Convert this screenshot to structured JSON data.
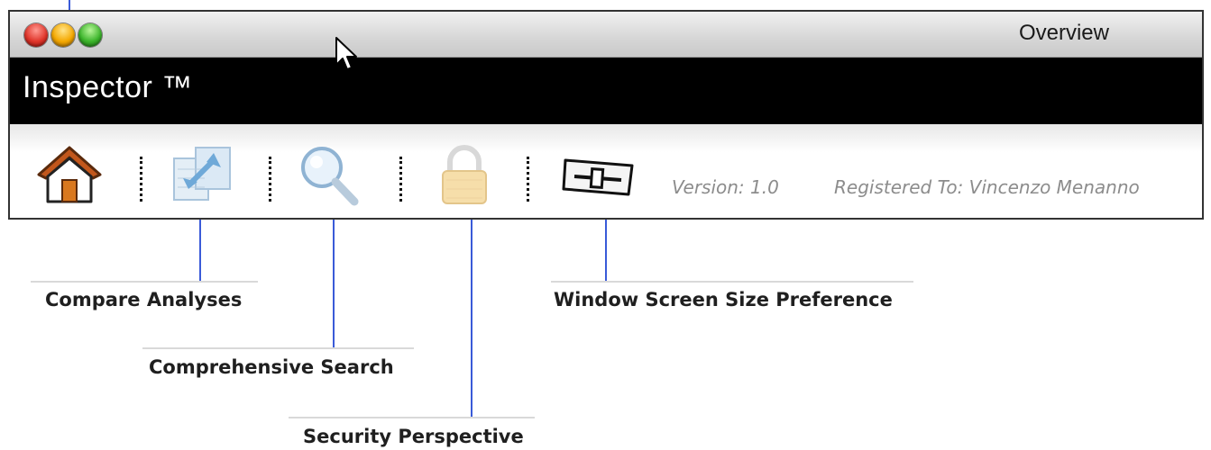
{
  "window": {
    "title": "Overview",
    "app_name": "Inspector ™"
  },
  "toolbar": {
    "buttons": [
      {
        "id": "home",
        "icon": "home-icon"
      },
      {
        "id": "compare",
        "icon": "compare-analyses-icon"
      },
      {
        "id": "search",
        "icon": "magnifier-icon"
      },
      {
        "id": "security",
        "icon": "padlock-icon"
      },
      {
        "id": "window-size",
        "icon": "slider-icon"
      }
    ],
    "version": "Version: 1.0",
    "registered": "Registered To: Vincenzo Menanno"
  },
  "callouts": {
    "compare": "Compare Analyses",
    "search": "Comprehensive Search",
    "security": "Security Perspective",
    "window_size": "Window Screen Size Preference"
  },
  "colors": {
    "callout_line": "#3a5bd8",
    "app_bar": "#000000",
    "info_text": "#8c8c8c"
  }
}
